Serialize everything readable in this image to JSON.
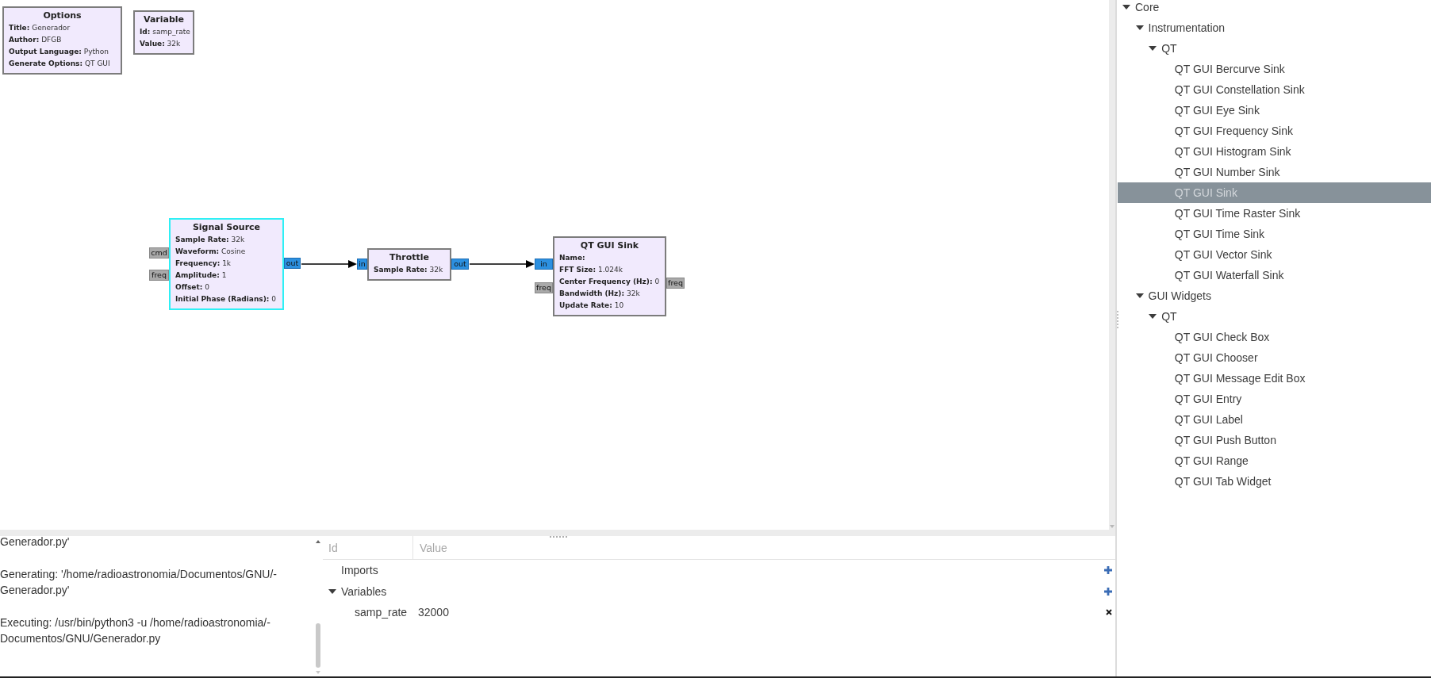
{
  "canvas": {
    "blocks": [
      {
        "title": "Options",
        "selected": false,
        "params": [
          {
            "label": "Title:",
            "value": "Generador"
          },
          {
            "label": "Author:",
            "value": "DFGB"
          },
          {
            "label": "Output Language:",
            "value": "Python"
          },
          {
            "label": "Generate Options:",
            "value": "QT GUI"
          }
        ]
      },
      {
        "title": "Variable",
        "selected": false,
        "params": [
          {
            "label": "Id:",
            "value": "samp_rate"
          },
          {
            "label": "Value:",
            "value": "32k"
          }
        ]
      },
      {
        "title": "Signal Source",
        "selected": true,
        "params": [
          {
            "label": "Sample Rate:",
            "value": "32k"
          },
          {
            "label": "Waveform:",
            "value": "Cosine"
          },
          {
            "label": "Frequency:",
            "value": "1k"
          },
          {
            "label": "Amplitude:",
            "value": "1"
          },
          {
            "label": "Offset:",
            "value": "0"
          },
          {
            "label": "Initial Phase (Radians):",
            "value": "0"
          }
        ],
        "inputs": [
          {
            "label": "cmd",
            "kind": "message"
          },
          {
            "label": "freq",
            "kind": "message"
          }
        ],
        "outputs": [
          {
            "label": "out",
            "kind": "stream"
          }
        ]
      },
      {
        "title": "Throttle",
        "selected": false,
        "params": [
          {
            "label": "Sample Rate:",
            "value": "32k"
          }
        ],
        "inputs": [
          {
            "label": "in",
            "kind": "stream"
          }
        ],
        "outputs": [
          {
            "label": "out",
            "kind": "stream"
          }
        ]
      },
      {
        "title": "QT GUI Sink",
        "selected": false,
        "params": [
          {
            "label": "Name:"
          },
          {
            "label": "FFT Size:",
            "value": "1.024k"
          },
          {
            "label": "Center Frequency (Hz):",
            "value": "0"
          },
          {
            "label": "Bandwidth (Hz):",
            "value": "32k"
          },
          {
            "label": "Update Rate:",
            "value": "10"
          }
        ],
        "inputs": [
          {
            "label": "in",
            "kind": "stream"
          },
          {
            "label": "freq",
            "kind": "message"
          }
        ],
        "outputs": [
          {
            "label": "freq",
            "kind": "message"
          }
        ]
      }
    ]
  },
  "block_library": {
    "tree": [
      {
        "label": "Core",
        "expanded": true,
        "selected": false,
        "children": [
          {
            "label": "Instrumentation",
            "expanded": true,
            "selected": false,
            "children": [
              {
                "label": "QT",
                "expanded": true,
                "selected": false,
                "children": [
                  {
                    "label": "QT GUI Bercurve Sink",
                    "selected": false
                  },
                  {
                    "label": "QT GUI Constellation Sink",
                    "selected": false
                  },
                  {
                    "label": "QT GUI Eye Sink",
                    "selected": false
                  },
                  {
                    "label": "QT GUI Frequency Sink",
                    "selected": false
                  },
                  {
                    "label": "QT GUI Histogram Sink",
                    "selected": false
                  },
                  {
                    "label": "QT GUI Number Sink",
                    "selected": false
                  },
                  {
                    "label": "QT GUI Sink",
                    "selected": true
                  },
                  {
                    "label": "QT GUI Time Raster Sink",
                    "selected": false
                  },
                  {
                    "label": "QT GUI Time Sink",
                    "selected": false
                  },
                  {
                    "label": "QT GUI Vector Sink",
                    "selected": false
                  },
                  {
                    "label": "QT GUI Waterfall Sink",
                    "selected": false
                  }
                ]
              }
            ]
          },
          {
            "label": "GUI Widgets",
            "expanded": true,
            "selected": false,
            "children": [
              {
                "label": "QT",
                "expanded": true,
                "selected": false,
                "children": [
                  {
                    "label": "QT GUI Check Box",
                    "selected": false
                  },
                  {
                    "label": "QT GUI Chooser",
                    "selected": false
                  },
                  {
                    "label": "QT GUI Message Edit Box",
                    "selected": false
                  },
                  {
                    "label": "QT GUI Entry",
                    "selected": false
                  },
                  {
                    "label": "QT GUI Label",
                    "selected": false
                  },
                  {
                    "label": "QT GUI Push Button",
                    "selected": false
                  },
                  {
                    "label": "QT GUI Range",
                    "selected": false
                  },
                  {
                    "label": "QT GUI Tab Widget",
                    "selected": false
                  }
                ]
              }
            ]
          }
        ]
      }
    ]
  },
  "console": {
    "messages": [
      {
        "lines": [
          "Generador.py'"
        ]
      },
      {
        "lines": [
          "Generating: '/home/radioastronomia/Documentos/GNU/-",
          "Generador.py'"
        ]
      },
      {
        "lines": [
          "Executing: /usr/bin/python3 -u /home/radioastronomia/-",
          "Documentos/GNU/Generador.py"
        ]
      }
    ]
  },
  "variables": {
    "columns": [
      "Id",
      "Value"
    ],
    "items": [
      {
        "id": "Imports",
        "kind": "category"
      },
      {
        "id": "Variables",
        "kind": "category",
        "expanded": true,
        "children": [
          {
            "id": "samp_rate",
            "value": "32000",
            "kind": "variable"
          }
        ]
      }
    ]
  }
}
